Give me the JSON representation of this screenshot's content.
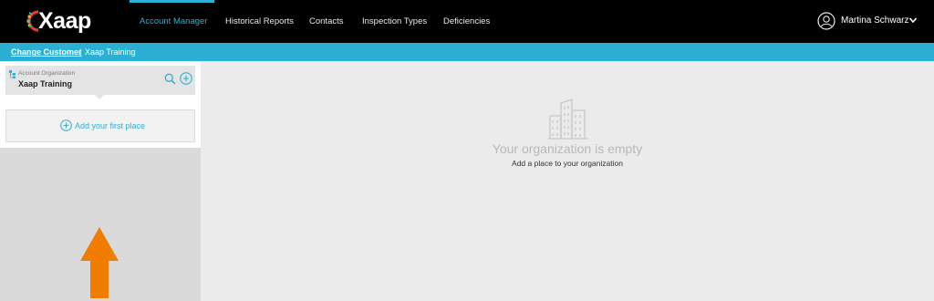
{
  "app": {
    "logo_text": "Xaap",
    "accent_color": "#2bb0d4",
    "arrow_color": "#f07d00"
  },
  "nav": {
    "items": [
      {
        "label": "Account Manager",
        "active": true
      },
      {
        "label": "Historical Reports",
        "active": false
      },
      {
        "label": "Contacts",
        "active": false
      },
      {
        "label": "Inspection Types",
        "active": false
      },
      {
        "label": "Deficiencies",
        "active": false
      }
    ]
  },
  "user": {
    "name": "Martina Schwarz",
    "avatar_icon": "user-circle-icon",
    "menu_icon": "chevron-down-icon"
  },
  "subbar": {
    "change_customer_label": "Change Customer",
    "separator": "|",
    "customer_name": "Xaap Training"
  },
  "sidebar": {
    "org_label": "Account Organization",
    "org_name": "Xaap Training",
    "org_icon": "org-tree-icon",
    "search_icon": "search-icon",
    "add_icon": "plus-circle-icon",
    "add_place_label": "Add your first place"
  },
  "main": {
    "empty_icon": "buildings-icon",
    "empty_title": "Your organization is empty",
    "empty_subtitle": "Add a place to your organization"
  }
}
